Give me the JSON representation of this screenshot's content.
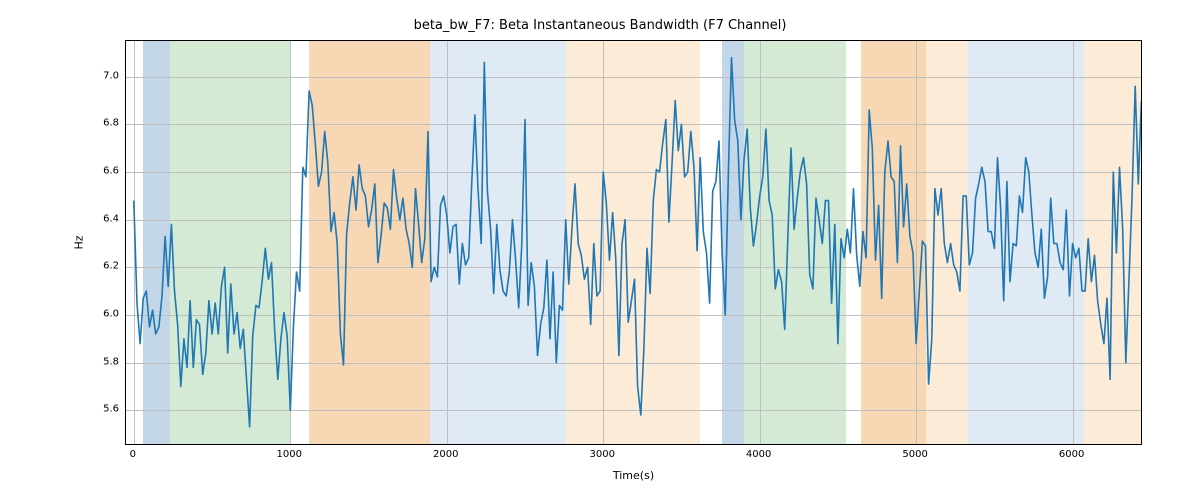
{
  "chart_data": {
    "type": "line",
    "title": "beta_bw_F7: Beta Instantaneous Bandwidth (F7 Channel)",
    "xlabel": "Time(s)",
    "ylabel": "Hz",
    "xlim": [
      -50,
      6450
    ],
    "ylim": [
      5.45,
      7.15
    ],
    "xticks": [
      0,
      1000,
      2000,
      3000,
      4000,
      5000,
      6000
    ],
    "yticks": [
      5.6,
      5.8,
      6.0,
      6.2,
      6.4,
      6.6,
      6.8,
      7.0
    ],
    "line_color": "#1f77b4",
    "span_regions": [
      {
        "x0": 60,
        "x1": 230,
        "class": "blue-dark"
      },
      {
        "x0": 230,
        "x1": 1000,
        "class": "green"
      },
      {
        "x0": 1120,
        "x1": 1890,
        "class": "orange-dark"
      },
      {
        "x0": 1890,
        "x1": 2760,
        "class": "blue-light"
      },
      {
        "x0": 2760,
        "x1": 3620,
        "class": "orange-light"
      },
      {
        "x0": 3760,
        "x1": 3900,
        "class": "blue-dark"
      },
      {
        "x0": 3900,
        "x1": 4550,
        "class": "green"
      },
      {
        "x0": 4650,
        "x1": 5060,
        "class": "orange-dark"
      },
      {
        "x0": 5060,
        "x1": 5330,
        "class": "orange-light"
      },
      {
        "x0": 5330,
        "x1": 6070,
        "class": "blue-light"
      },
      {
        "x0": 6070,
        "x1": 6450,
        "class": "orange-light"
      }
    ],
    "series": [
      {
        "name": "beta_bw_F7",
        "x_step": 20,
        "x_start": 0,
        "values": [
          6.48,
          6.05,
          5.88,
          6.07,
          6.1,
          5.95,
          6.02,
          5.92,
          5.95,
          6.08,
          6.33,
          6.12,
          6.38,
          6.1,
          5.96,
          5.7,
          5.9,
          5.78,
          6.06,
          5.78,
          5.98,
          5.96,
          5.75,
          5.84,
          6.06,
          5.92,
          6.05,
          5.92,
          6.12,
          6.2,
          5.84,
          6.13,
          5.92,
          6.01,
          5.86,
          5.94,
          5.73,
          5.53,
          5.91,
          6.04,
          6.03,
          6.14,
          6.28,
          6.15,
          6.22,
          5.94,
          5.73,
          5.9,
          6.01,
          5.91,
          5.6,
          5.95,
          6.18,
          6.1,
          6.62,
          6.58,
          6.94,
          6.88,
          6.72,
          6.54,
          6.6,
          6.77,
          6.64,
          6.35,
          6.43,
          6.3,
          5.92,
          5.79,
          6.34,
          6.47,
          6.58,
          6.44,
          6.63,
          6.53,
          6.5,
          6.37,
          6.44,
          6.55,
          6.22,
          6.33,
          6.47,
          6.45,
          6.36,
          6.61,
          6.49,
          6.4,
          6.49,
          6.36,
          6.3,
          6.2,
          6.53,
          6.38,
          6.22,
          6.32,
          6.77,
          6.14,
          6.2,
          6.16,
          6.46,
          6.5,
          6.42,
          6.26,
          6.37,
          6.38,
          6.13,
          6.3,
          6.21,
          6.24,
          6.56,
          6.84,
          6.53,
          6.3,
          7.06,
          6.52,
          6.36,
          6.09,
          6.38,
          6.19,
          6.1,
          6.08,
          6.18,
          6.4,
          6.23,
          6.03,
          6.3,
          6.82,
          6.04,
          6.22,
          6.12,
          5.83,
          5.96,
          6.03,
          6.23,
          5.9,
          6.18,
          5.8,
          6.04,
          6.02,
          6.4,
          6.13,
          6.36,
          6.55,
          6.3,
          6.25,
          6.15,
          6.2,
          5.96,
          6.3,
          6.08,
          6.1,
          6.6,
          6.47,
          6.23,
          6.43,
          6.24,
          5.83,
          6.3,
          6.4,
          5.97,
          6.06,
          6.15,
          5.7,
          5.58,
          5.86,
          6.28,
          6.09,
          6.48,
          6.61,
          6.6,
          6.72,
          6.82,
          6.39,
          6.64,
          6.9,
          6.69,
          6.8,
          6.58,
          6.6,
          6.77,
          6.62,
          6.27,
          6.66,
          6.35,
          6.26,
          6.05,
          6.52,
          6.56,
          6.73,
          6.26,
          6.0,
          6.6,
          7.08,
          6.82,
          6.73,
          6.4,
          6.65,
          6.78,
          6.45,
          6.29,
          6.38,
          6.5,
          6.58,
          6.78,
          6.48,
          6.42,
          6.11,
          6.19,
          6.14,
          5.94,
          6.32,
          6.7,
          6.36,
          6.49,
          6.6,
          6.66,
          6.55,
          6.17,
          6.11,
          6.49,
          6.4,
          6.3,
          6.48,
          6.48,
          6.05,
          6.38,
          5.88,
          6.32,
          6.24,
          6.36,
          6.26,
          6.53,
          6.25,
          6.12,
          6.35,
          6.24,
          6.86,
          6.7,
          6.23,
          6.46,
          6.07,
          6.6,
          6.73,
          6.58,
          6.56,
          6.22,
          6.71,
          6.37,
          6.55,
          6.33,
          6.26,
          5.88,
          6.1,
          6.31,
          6.29,
          5.71,
          5.9,
          6.53,
          6.42,
          6.53,
          6.3,
          6.22,
          6.3,
          6.21,
          6.18,
          6.1,
          6.5,
          6.5,
          6.21,
          6.26,
          6.49,
          6.55,
          6.62,
          6.56,
          6.35,
          6.35,
          6.28,
          6.66,
          6.45,
          6.06,
          6.56,
          6.14,
          6.3,
          6.29,
          6.5,
          6.43,
          6.66,
          6.6,
          6.42,
          6.26,
          6.2,
          6.36,
          6.07,
          6.16,
          6.49,
          6.3,
          6.3,
          6.22,
          6.19,
          6.44,
          6.08,
          6.3,
          6.24,
          6.28,
          6.1,
          6.1,
          6.32,
          6.14,
          6.25,
          6.06,
          5.96,
          5.88,
          6.07,
          5.73,
          6.6,
          6.26,
          6.62,
          6.36,
          5.8,
          6.14,
          6.49,
          6.96,
          6.55,
          6.9
        ]
      }
    ]
  }
}
